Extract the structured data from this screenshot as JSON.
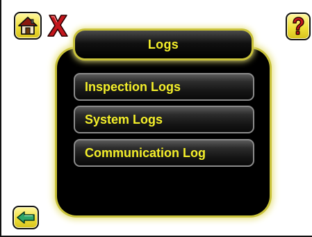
{
  "title": "Logs",
  "menu": {
    "items": [
      {
        "label": "Inspection Logs"
      },
      {
        "label": "System Logs"
      },
      {
        "label": "Communication Log"
      }
    ]
  },
  "icons": {
    "home": "home-icon",
    "close": "close-icon",
    "help": "help-icon",
    "back": "back-arrow-icon"
  },
  "colors": {
    "accent_text": "#f4ef2a",
    "button_yellow": "#f0e03a",
    "panel_bg": "#000000",
    "glow": "#e6e07a",
    "close_red": "#c4161c",
    "back_green": "#2fa66a"
  }
}
